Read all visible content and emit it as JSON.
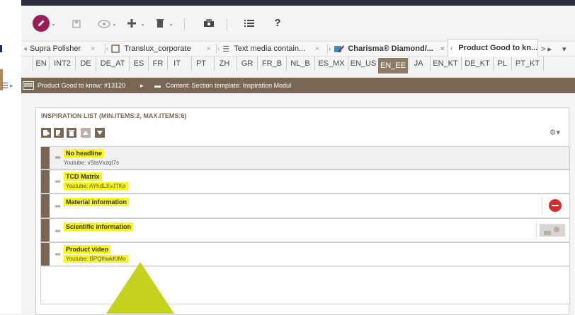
{
  "toolbar": {
    "help_label": "?",
    "icons": [
      "edit-icon",
      "save-icon",
      "preview-icon",
      "add-icon",
      "delete-icon",
      "print-icon",
      "list-icon",
      "help-icon"
    ]
  },
  "tabs": [
    {
      "label": "Supra Polisher",
      "close": "×"
    },
    {
      "label": "Translux_corporate",
      "close": "×"
    },
    {
      "label": "Text media contain...",
      "close": "×"
    },
    {
      "label": "Charisma® Diamond/...",
      "close": "×"
    },
    {
      "label": "Product Good to kn...",
      "close": ""
    }
  ],
  "tab_scroll": {
    "right": "> ▸",
    "menu": "▾"
  },
  "languages": [
    "EN",
    "INT2",
    "DE",
    "DE_AT",
    "ES",
    "FR",
    "IT",
    "PT",
    "ZH",
    "GR",
    "FR_B",
    "NL_B",
    "ES_MX",
    "EN_US",
    "EN_EE",
    "JA",
    "EN_KT",
    "DE_KT",
    "PL",
    "PT_KT"
  ],
  "active_language": "EN_EE",
  "breadcrumb": {
    "item1": "Product Good to know: #13120",
    "item2": "Content: Section template: Inspiration Modul"
  },
  "panel": {
    "title": "INSPIRATION LIST (MIN.ITEMS:2, MAX.ITEMS:6)"
  },
  "rows": [
    {
      "title": "No headline",
      "sub": "Youtube: vStaVxzqt7s"
    },
    {
      "title": "TCD Matrix",
      "sub": "Youtube: AYhdLXvJTKo"
    },
    {
      "title": "Material information",
      "sub": ""
    },
    {
      "title": "Scientific information",
      "sub": ""
    },
    {
      "title": "Product video",
      "sub": "Youtube: BPQlhwkKlMo"
    }
  ],
  "colors": {
    "accent_brown": "#7a6753",
    "edit_button": "#9b1d55",
    "highlight": "#f8f61e",
    "arrow": "#c5d21e"
  }
}
